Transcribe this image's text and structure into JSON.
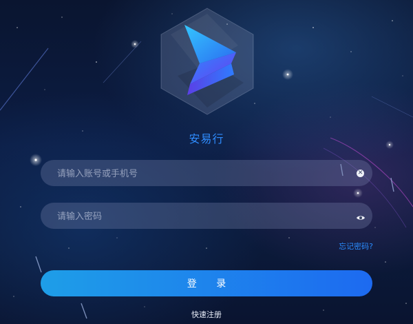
{
  "app": {
    "name": "安易行"
  },
  "login_form": {
    "account_placeholder": "请输入账号或手机号",
    "password_placeholder": "请输入密码",
    "forgot_password": "忘记密码?",
    "login_button": "登 录",
    "register_link": "快速注册"
  },
  "icons": {
    "account_clear": "clear-circle-icon",
    "password_toggle": "eye-icon"
  },
  "colors": {
    "accent": "#2f8dff",
    "button_start": "#1e9ee8",
    "button_end": "#1d6af0",
    "field_background": "#4a5478"
  }
}
